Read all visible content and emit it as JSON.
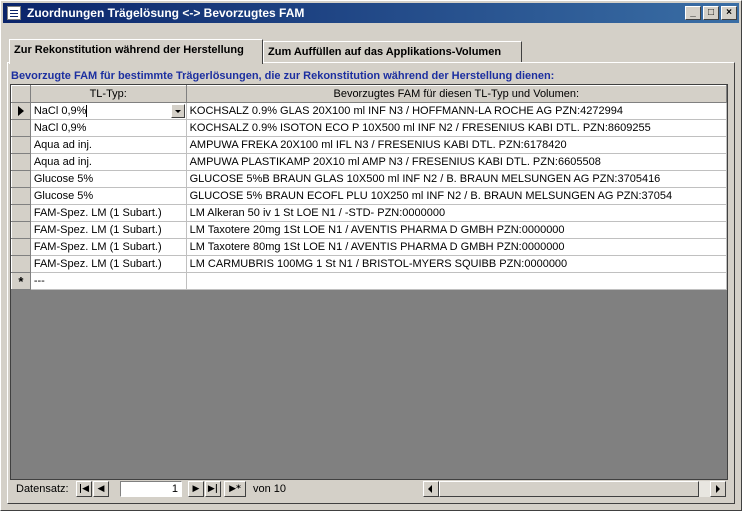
{
  "window": {
    "title": "Zuordnungen Trägelösung <-> Bevorzugtes FAM",
    "minimize": "_",
    "maximize": "□",
    "close": "×"
  },
  "tabs": [
    {
      "label": "Zur Rekonstitution während der Herstellung",
      "active": true
    },
    {
      "label": "Zum Auffüllen auf das Applikations-Volumen",
      "active": false
    }
  ],
  "caption": "Bevorzugte FAM für bestimmte Trägerlösungen, die zur Rekonstitution während der Herstellung dienen:",
  "table": {
    "headers": [
      "TL-Typ:",
      "Bevorzugtes FAM für diesen TL-Typ und Volumen:"
    ],
    "rows": [
      {
        "tl": "NaCl 0,9%",
        "fam": "KOCHSALZ 0.9% GLAS   20X100 ml INF N3 / HOFFMANN-LA ROCHE AG PZN:4272994"
      },
      {
        "tl": "NaCl 0,9%",
        "fam": "KOCHSALZ 0.9% ISOTON ECO P   10X500 ml INF N2 / FRESENIUS KABI DTL. PZN:8609255"
      },
      {
        "tl": "Aqua ad inj.",
        "fam": "AMPUWA FREKA   20X100 ml IFL N3 / FRESENIUS KABI DTL. PZN:6178420"
      },
      {
        "tl": "Aqua ad inj.",
        "fam": "AMPUWA PLASTIKAMP   20X10 ml AMP N3 / FRESENIUS KABI DTL. PZN:6605508"
      },
      {
        "tl": "Glucose 5%",
        "fam": "GLUCOSE 5%B BRAUN GLAS   10X500 ml INF N2 / B. BRAUN MELSUNGEN AG PZN:3705416"
      },
      {
        "tl": "Glucose 5%",
        "fam": "GLUCOSE 5% BRAUN ECOFL PLU   10X250 ml INF N2 / B. BRAUN MELSUNGEN AG PZN:37054"
      },
      {
        "tl": "FAM-Spez. LM (1 Subart.)",
        "fam": "LM Alkeran 50 iv   1 St LOE N1 / -STD- PZN:0000000"
      },
      {
        "tl": "FAM-Spez. LM (1 Subart.)",
        "fam": "LM Taxotere 20mg   1St LOE N1 / AVENTIS PHARMA D GMBH PZN:0000000"
      },
      {
        "tl": "FAM-Spez. LM (1 Subart.)",
        "fam": "LM Taxotere 80mg   1St LOE N1 / AVENTIS PHARMA D GMBH PZN:0000000"
      },
      {
        "tl": "FAM-Spez. LM (1 Subart.)",
        "fam": "LM CARMUBRIS 100MG   1 St  N1 / BRISTOL-MYERS SQUIBB PZN:0000000"
      }
    ],
    "new_row": {
      "marker": "*",
      "tl": "---",
      "fam": ""
    }
  },
  "navigation": {
    "label": "Datensatz:",
    "first": "|◀",
    "prev": "◀",
    "current": "1",
    "next": "▶",
    "last": "▶|",
    "new": "▶*",
    "of_text": "von  10"
  }
}
